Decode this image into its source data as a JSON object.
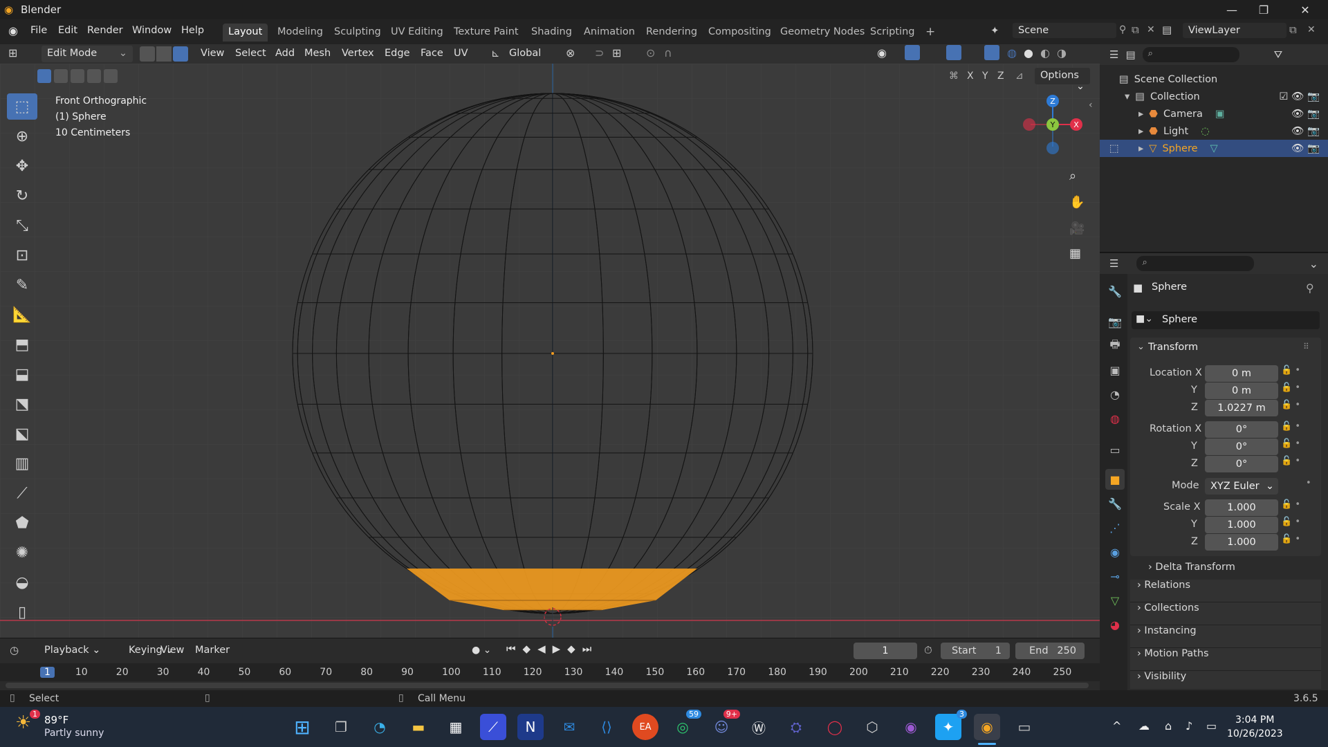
{
  "app": {
    "title": "Blender",
    "version": "3.6.5"
  },
  "menubar": {
    "items": [
      "File",
      "Edit",
      "Render",
      "Window",
      "Help"
    ]
  },
  "workspaces": {
    "tabs": [
      "Layout",
      "Modeling",
      "Sculpting",
      "UV Editing",
      "Texture Paint",
      "Shading",
      "Animation",
      "Rendering",
      "Compositing",
      "Geometry Nodes",
      "Scripting"
    ],
    "active": "Layout"
  },
  "scene": {
    "name": "Scene",
    "view_layer": "ViewLayer"
  },
  "viewport_header": {
    "mode": "Edit Mode",
    "menus": [
      "View",
      "Select",
      "Add",
      "Mesh",
      "Vertex",
      "Edge",
      "Face",
      "UV"
    ],
    "orientation": "Global",
    "options_label": "Options",
    "axes": [
      "X",
      "Y",
      "Z"
    ]
  },
  "viewport": {
    "view_name": "Front Orthographic",
    "object_label": "(1) Sphere",
    "scale_label": "10 Centimeters",
    "gizmo": {
      "x": "X",
      "y": "Y",
      "z": "Z"
    }
  },
  "outliner": {
    "rows": [
      {
        "label": "Scene Collection"
      },
      {
        "label": "Collection"
      },
      {
        "label": "Camera"
      },
      {
        "label": "Light"
      },
      {
        "label": "Sphere"
      }
    ]
  },
  "properties": {
    "object_name": "Sphere",
    "datablock_name": "Sphere",
    "transform_label": "Transform",
    "location_label": "Location X",
    "rotation_label": "Rotation X",
    "scale_label": "Scale X",
    "y_label": "Y",
    "z_label": "Z",
    "mode_label": "Mode",
    "location": {
      "x": "0 m",
      "y": "0 m",
      "z": "1.0227 m"
    },
    "rotation": {
      "x": "0°",
      "y": "0°",
      "z": "0°"
    },
    "rotation_mode": "XYZ Euler",
    "scale": {
      "x": "1.000",
      "y": "1.000",
      "z": "1.000"
    },
    "subpanels": [
      "Delta Transform",
      "Relations",
      "Collections",
      "Instancing",
      "Motion Paths",
      "Visibility"
    ]
  },
  "timeline": {
    "menus": [
      "Playback",
      "Keying",
      "View",
      "Marker"
    ],
    "current_frame": "1",
    "start_label": "Start",
    "start": "1",
    "end_label": "End",
    "end": "250",
    "ticks": [
      "1",
      "10",
      "20",
      "30",
      "40",
      "50",
      "60",
      "70",
      "80",
      "90",
      "100",
      "110",
      "120",
      "130",
      "140",
      "150",
      "160",
      "170",
      "180",
      "190",
      "200",
      "210",
      "220",
      "230",
      "240",
      "250"
    ]
  },
  "statusbar": {
    "left": "Select",
    "middle": "Call Menu",
    "version": "3.6.5"
  },
  "taskbar": {
    "weather_temp": "89°F",
    "weather_desc": "Partly sunny",
    "weather_badge": "1",
    "whatsapp_badge": "59",
    "discord_badge": "9+",
    "twitter_badge": "3",
    "time": "3:04 PM",
    "date": "10/26/2023"
  },
  "colors": {
    "selection": "#4772b3",
    "active_object": "#f5a623",
    "selected_faces": "#f39c1f",
    "axis_x": "#e0304a",
    "axis_y": "#8cc63f",
    "axis_z": "#2e7bd6"
  }
}
